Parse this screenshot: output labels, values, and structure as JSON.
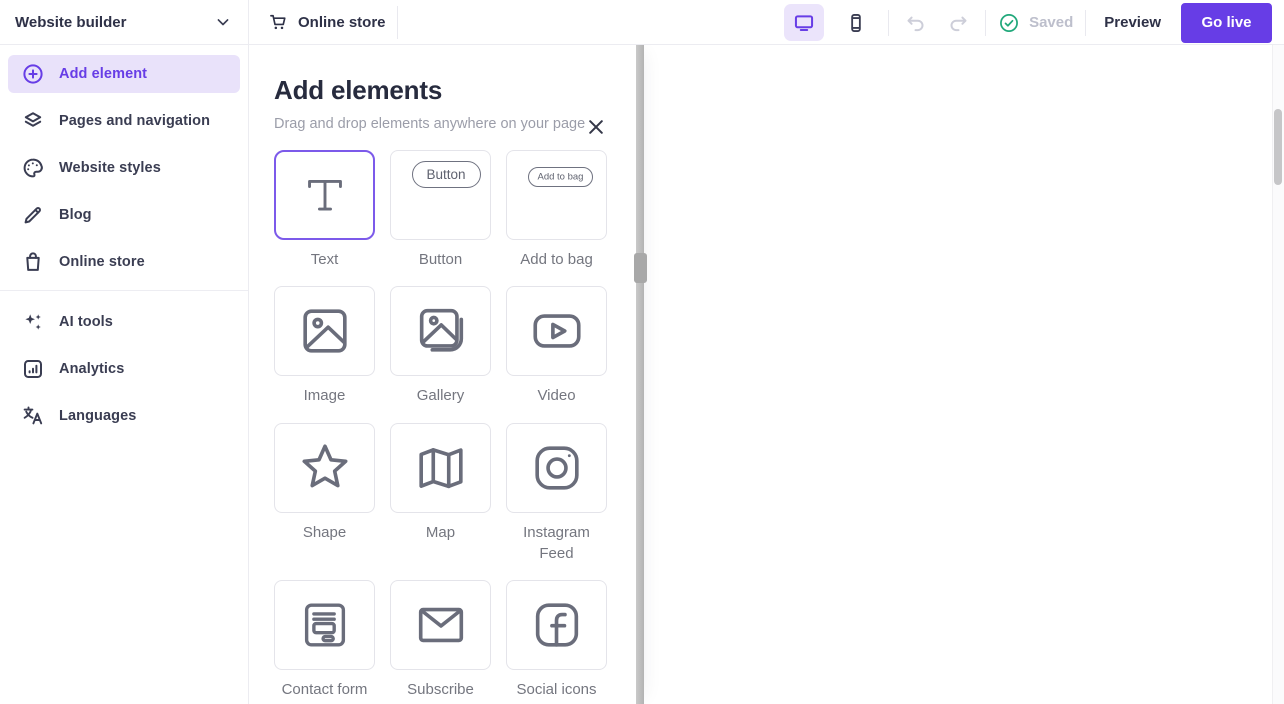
{
  "topbar": {
    "builder_label": "Website builder",
    "store_label": "Online store",
    "saved_label": "Saved",
    "preview_label": "Preview",
    "golive_label": "Go live",
    "icons": {
      "builder_chevron": "chevron-down",
      "store": "cart",
      "desktop": "desktop",
      "mobile": "mobile",
      "undo": "undo",
      "redo": "redo",
      "saved": "check-circle"
    }
  },
  "sidebar": {
    "items": [
      {
        "label": "Add element",
        "icon": "plus-circle",
        "active": true
      },
      {
        "label": "Pages and navigation",
        "icon": "layers"
      },
      {
        "label": "Website styles",
        "icon": "palette"
      },
      {
        "label": "Blog",
        "icon": "pencil"
      },
      {
        "label": "Online store",
        "icon": "shopping-bag",
        "divider_after": true
      },
      {
        "label": "AI tools",
        "icon": "sparkles"
      },
      {
        "label": "Analytics",
        "icon": "analytics"
      },
      {
        "label": "Languages",
        "icon": "translate"
      }
    ]
  },
  "panel": {
    "title": "Add elements",
    "subtitle": "Drag and drop elements anywhere on your page",
    "close_icon": "close",
    "tiles": [
      {
        "label": "Text",
        "icon": "text-serif",
        "selected": true
      },
      {
        "label": "Button",
        "icon": "button-pill",
        "pill_text": "Button"
      },
      {
        "label": "Add to bag",
        "icon": "button-pill-small",
        "pill_text": "Add to bag"
      },
      {
        "label": "Image",
        "icon": "image"
      },
      {
        "label": "Gallery",
        "icon": "gallery"
      },
      {
        "label": "Video",
        "icon": "video"
      },
      {
        "label": "Shape",
        "icon": "star"
      },
      {
        "label": "Map",
        "icon": "map"
      },
      {
        "label": "Instagram Feed",
        "icon": "instagram"
      },
      {
        "label": "Contact form",
        "icon": "contact-form"
      },
      {
        "label": "Subscribe",
        "icon": "envelope"
      },
      {
        "label": "Social icons",
        "icon": "facebook"
      }
    ]
  },
  "colors": {
    "accent": "#673DE6",
    "accent_light": "#EBE4FB",
    "sidebar_active_bg": "#E9E2FA",
    "dark_text": "#2E3147",
    "muted_text": "#74767F",
    "success_green": "#21A87B",
    "disabled_gray": "#CDCED9"
  }
}
